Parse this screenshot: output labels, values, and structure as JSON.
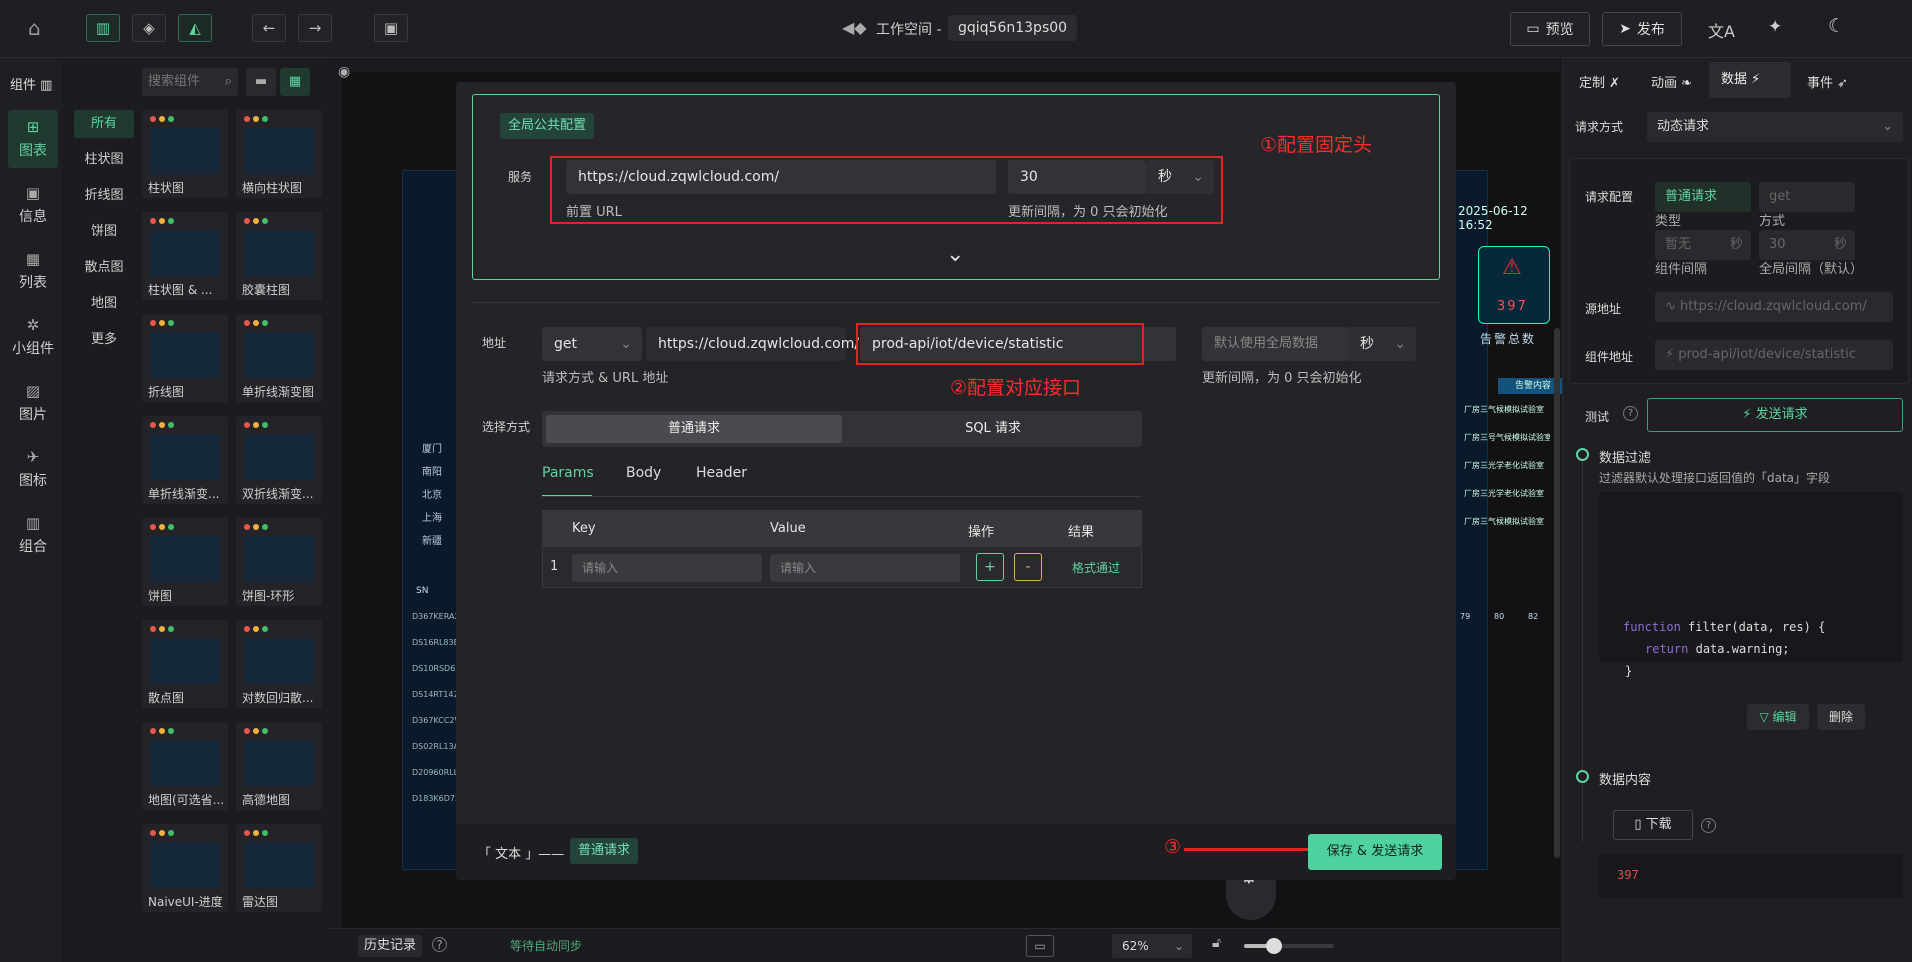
{
  "header": {
    "workspace_label": "工作空间 -",
    "workspace_id": "gqiq56n13ps00",
    "preview": "预览",
    "publish": "发布"
  },
  "leftnav": {
    "components_title": "组件",
    "items": [
      {
        "label": "图表"
      },
      {
        "label": "信息"
      },
      {
        "label": "列表"
      },
      {
        "label": "小组件"
      },
      {
        "label": "图片"
      },
      {
        "label": "图标"
      },
      {
        "label": "组合"
      }
    ]
  },
  "categories": [
    "所有",
    "柱状图",
    "折线图",
    "饼图",
    "散点图",
    "地图",
    "更多"
  ],
  "search": {
    "placeholder": "搜索组件"
  },
  "components": [
    "柱状图",
    "横向柱状图",
    "柱状图 & ...",
    "胶囊柱图",
    "折线图",
    "单折线渐变图",
    "单折线渐变...",
    "双折线渐变...",
    "饼图",
    "饼图-环形",
    "散点图",
    "对数回归散...",
    "地图(可选省...",
    "高德地图",
    "NaiveUI-进度",
    "雷达图"
  ],
  "modal": {
    "global_tag": "全局公共配置",
    "service_label": "服务",
    "base_url": "https://cloud.zqwlcloud.com/",
    "prefix_hint": "前置 URL",
    "interval": "30",
    "interval_unit": "秒",
    "interval_hint": "更新间隔，为 0 只会初始化",
    "anno1": "①配置固定头",
    "address_label": "地址",
    "method": "get",
    "address_base": "https://cloud.zqwlcloud.com/",
    "address_path": "prod-api/iot/device/statistic",
    "address_hint": "请求方式 & URL 地址",
    "default_interval": "默认使用全局数据",
    "unit2": "秒",
    "interval_hint2": "更新间隔，为 0 只会初始化",
    "anno2": "②配置对应接口",
    "select_label": "选择方式",
    "mode_normal": "普通请求",
    "mode_sql": "SQL 请求",
    "tabs": [
      "Params",
      "Body",
      "Header"
    ],
    "table": {
      "headers": [
        "Key",
        "Value",
        "操作",
        "结果"
      ],
      "row_index": "1",
      "key_placeholder": "请输入",
      "value_placeholder": "请输入",
      "plus": "+",
      "minus": "-",
      "result": "格式通过"
    },
    "footer_left": "「 文本 」——",
    "footer_tag": "普通请求",
    "anno3": "③",
    "save_button": "保存 & 发送请求"
  },
  "right": {
    "tabs": [
      "定制",
      "动画",
      "数据",
      "事件"
    ],
    "request_label": "请求方式",
    "request_value": "动态请求",
    "req_config_label": "请求配置",
    "req_type_value": "普通请求",
    "req_method_value": "get",
    "type_label": "类型",
    "method_label": "方式",
    "comp_interval_value": "暂无",
    "comp_interval_unit": "秒",
    "global_interval_value": "30",
    "global_interval_unit": "秒",
    "comp_interval_label": "组件间隔",
    "global_interval_label": "全局间隔（默认）",
    "source_label": "源地址",
    "source_value": "https://cloud.zqwlcloud.com/",
    "comp_address_label": "组件地址",
    "comp_address_value": "prod-api/iot/device/statistic",
    "test_label": "测试",
    "send_button": "发送请求",
    "filter_title": "数据过滤",
    "filter_desc": "过滤器默认处理接口返回值的「data」字段",
    "code_kw": "function",
    "code_sig": "filter(data, res) {",
    "code_ret": "return",
    "code_body": "data.warning;",
    "code_close": "}",
    "edit": "编辑",
    "delete": "删除",
    "content_title": "数据内容",
    "download": "下载",
    "result_value": "397"
  },
  "canvas_preview": {
    "date": "2025-06-12 16:52",
    "count": "397",
    "count_label": "告警总数",
    "alarm_header": "告警内容",
    "cities": [
      "厦门",
      "南阳",
      "北京",
      "上海",
      "新疆"
    ],
    "sn_header": "SN",
    "sn_rows": [
      "D367KERA2",
      "DS16RL83E",
      "DS10RSD62",
      "DS14RT142",
      "D367KCC2V",
      "DS02RL13A",
      "D20960RLL",
      "D183K6D75"
    ],
    "alarm_rows": [
      "厂房三气候模拟试验室",
      "厂房三号气候模拟试验室",
      "厂房三光学老化试验室",
      "厂房三光学老化试验室",
      "厂房三气候模拟试验室"
    ],
    "axis_ticks": [
      "79",
      "80",
      "82"
    ]
  },
  "bottom": {
    "history": "历史记录",
    "autosave": "等待自动同步",
    "zoom": "62%"
  }
}
